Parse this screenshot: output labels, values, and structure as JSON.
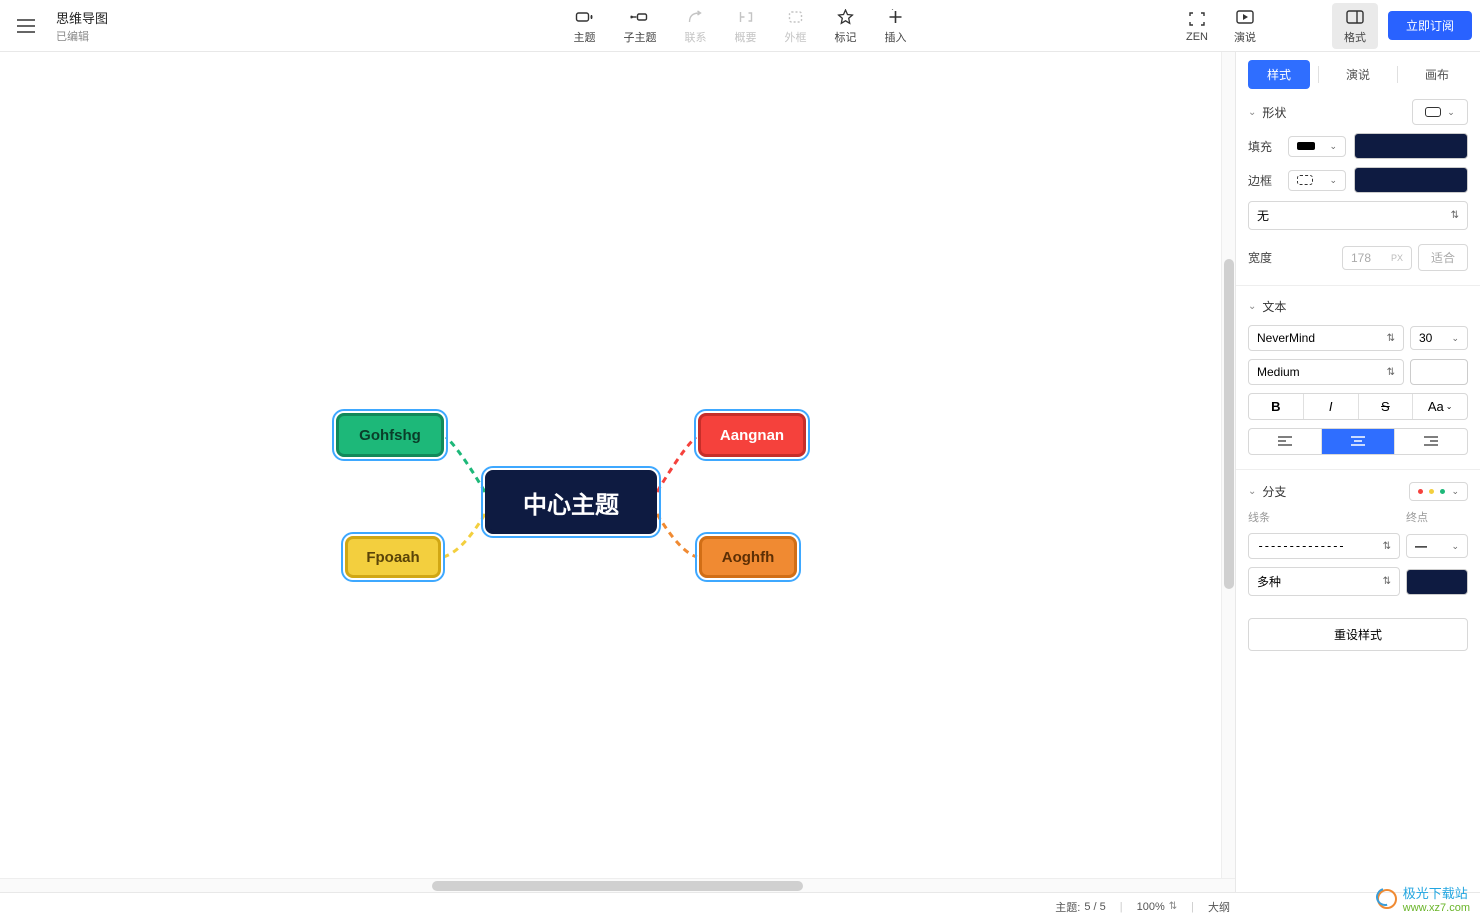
{
  "header": {
    "title": "思维导图",
    "subtitle": "已编辑",
    "subscribe": "立即订阅"
  },
  "toolbar": {
    "topic": "主题",
    "subtopic": "子主题",
    "relation": "联系",
    "summary": "概要",
    "boundary": "外框",
    "marker": "标记",
    "insert": "插入",
    "zen": "ZEN",
    "present": "演说",
    "format": "格式"
  },
  "window_controls": {
    "min": "—",
    "max": "☐",
    "close": "✕"
  },
  "nodes": {
    "center": "中心主题",
    "tl": "Gohfshg",
    "tr": "Aangnan",
    "bl": "Fpoaah",
    "br": "Aoghfh"
  },
  "panel": {
    "tabs": {
      "style": "样式",
      "present": "演说",
      "canvas": "画布"
    },
    "shape": {
      "label": "形状"
    },
    "fill": {
      "label": "填充",
      "color": "#0e1b41"
    },
    "border": {
      "label": "边框",
      "color": "#0e1b41",
      "style_none": "无"
    },
    "width": {
      "label": "宽度",
      "value": "178",
      "unit": "PX",
      "fit": "适合"
    },
    "text": {
      "label": "文本",
      "font": "NeverMind",
      "size": "30",
      "weight": "Medium",
      "bold": "B",
      "italic": "I",
      "strike": "S",
      "case": "Aa"
    },
    "branch": {
      "label": "分支",
      "line_lbl": "线条",
      "end_lbl": "终点",
      "dash_pattern": "--------------",
      "end_style": "—",
      "color_mode": "多种",
      "color": "#0e1b41"
    },
    "reset": "重设样式"
  },
  "status": {
    "topics_label": "主题:",
    "topics_value": "5 / 5",
    "zoom": "100%",
    "outline": "大纲"
  },
  "watermark": {
    "brand": "极光下载站",
    "url": "www.xz7.com"
  },
  "colors": {
    "accent": "#2f6eff",
    "green": "#1db879",
    "red": "#f5413c",
    "yellow": "#f3cf3e",
    "orange": "#f08a32",
    "navy": "#0e1b41"
  }
}
